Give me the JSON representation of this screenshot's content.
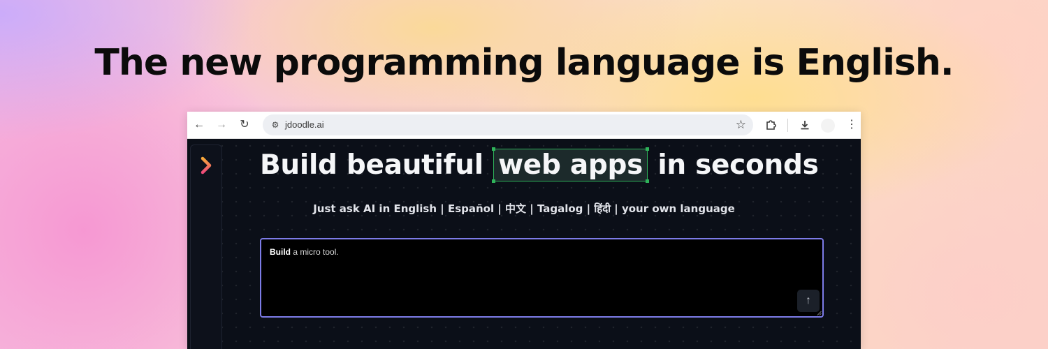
{
  "banner": {
    "headline": "The new programming language is English."
  },
  "browser": {
    "url": "jdoodle.ai",
    "icons": [
      "back-arrow-icon",
      "forward-arrow-icon",
      "reload-icon",
      "site-settings-icon",
      "bookmark-star-icon",
      "extensions-puzzle-icon",
      "download-icon",
      "more-vert-icon"
    ]
  },
  "app": {
    "hero": {
      "prefix": "Build beautiful",
      "highlight": "web apps",
      "suffix": "in seconds"
    },
    "subtitle": "Just ask AI in English | Español | 中文 | Tagalog | हिंदी | your own language",
    "prompt": {
      "bold": "Build",
      "rest": " a micro tool."
    },
    "colors": {
      "background": "#0b0f18",
      "highlight_border": "#2fb35a",
      "prompt_border": "#7d7ce8"
    }
  }
}
